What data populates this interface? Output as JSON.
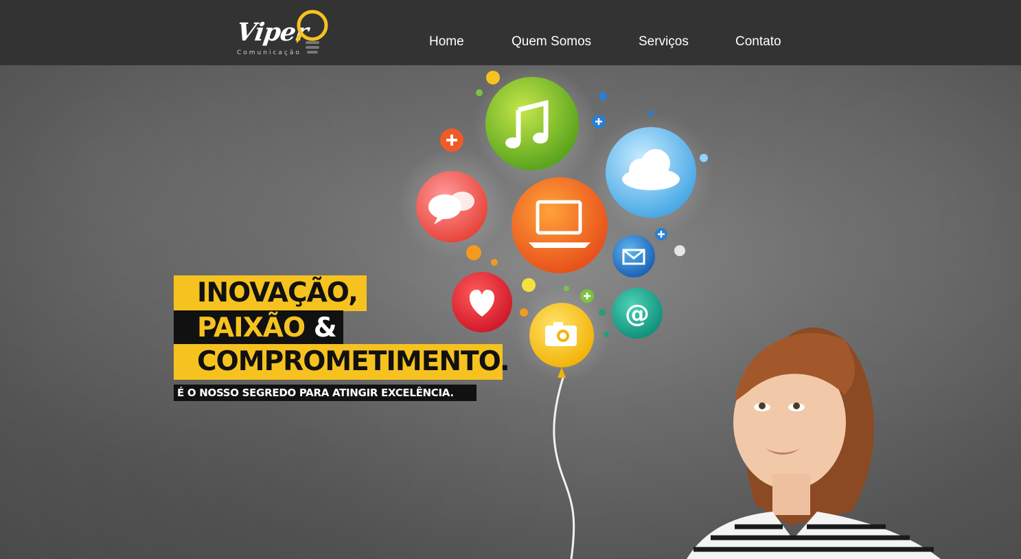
{
  "brand": {
    "name": "Viper",
    "tagline": "Comunicação",
    "accent_color": "#f6c21f",
    "header_bg": "#333333"
  },
  "nav": {
    "items": [
      {
        "label": "Home"
      },
      {
        "label": "Quem Somos"
      },
      {
        "label": "Serviços"
      },
      {
        "label": "Contato"
      }
    ]
  },
  "hero": {
    "line1": "INOVAÇÃO,",
    "line2_main": "PAIXÃO",
    "line2_amp": "&",
    "line3": "COMPROMETIMENTO.",
    "subline": "É O NOSSO SEGREDO PARA ATINGIR EXCELÊNCIA.",
    "icons": [
      "music-note-icon",
      "plus-icon",
      "speech-bubbles-icon",
      "laptop-icon",
      "cloud-icon",
      "envelope-icon",
      "heart-icon",
      "camera-icon",
      "at-sign-icon"
    ]
  }
}
